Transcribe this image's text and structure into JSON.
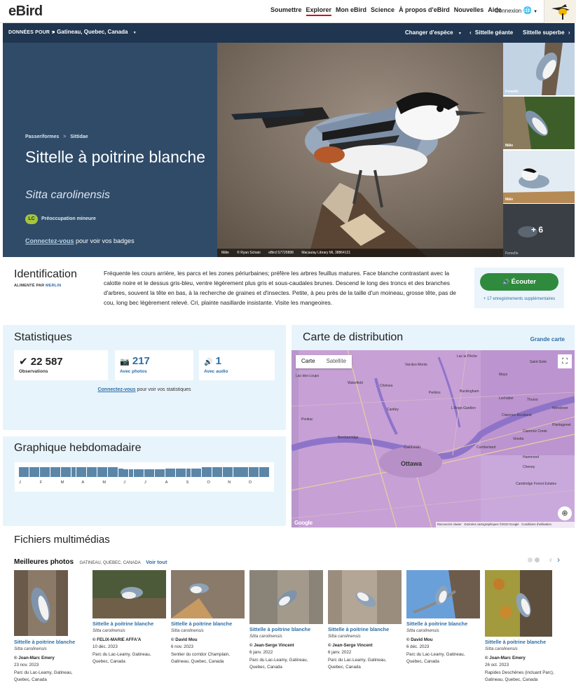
{
  "nav": {
    "logo": "eBird",
    "links": [
      "Soumettre",
      "Explorer",
      "Mon eBird",
      "Science",
      "À propos d'eBird",
      "Nouvelles",
      "Aide"
    ],
    "active": "Explorer",
    "login": "Connexion"
  },
  "subbar": {
    "label": "DONNÉES POUR :",
    "location": "Gatineau, Quebec, Canada",
    "change_species": "Changer d'espèce",
    "prev_species": "Sittelle géante",
    "next_species": "Sittelle superbe"
  },
  "hero": {
    "crumb_order": "Passeriformes",
    "crumb_family": "Sittidae",
    "title": "Sittelle à poitrine blanche",
    "sci_name": "Sitta carolinensis",
    "status_code": "LC",
    "status_label": "Préoccupation mineure",
    "badges_link": "Connectez-vous",
    "badges_text": " pour voir vos badges",
    "caption": {
      "sex": "Mâle",
      "credit": "© Ryan Schain",
      "ebird": "eBird S7720898",
      "library": "Macaulay Library ML 38864121"
    },
    "thumbs": [
      {
        "label": "Femelle"
      },
      {
        "label": "Mâle"
      },
      {
        "label": "Mâle"
      },
      {
        "label": "Femelle"
      }
    ],
    "more_count": "+ 6"
  },
  "identification": {
    "heading": "Identification",
    "powered_by": "ALIMENTÉ PAR",
    "powered_name": "MERLIN",
    "description": "Fréquente les cours arrière, les parcs et les zones périurbaines; préfère les arbres feuillus matures. Face blanche contrastant avec la calotte noire et le dessus gris-bleu, ventre légèrement plus gris et sous-caudales brunes. Descend le long des troncs et des branches d'arbres, souvent la tête en bas, à la recherche de graines et d'insectes. Petite, à peu près de la taille d'un moineau, grosse tête, pas de cou, long bec légèrement relevé. Cri, plainte nasillarde insistante. Visite les mangeoires.",
    "listen": "Écouter",
    "more_recordings": "+ 17 enregistrements supplémentaires"
  },
  "stats": {
    "heading": "Statistiques",
    "observations_value": "22 587",
    "observations_label": "Observations",
    "photos_value": "217",
    "photos_label": "Avec photos",
    "audio_value": "1",
    "audio_label": "Avec audio",
    "login_link": "Connectez-vous",
    "login_text": " pour voir vos statistiques"
  },
  "weekly": {
    "heading": "Graphique hebdomadaire",
    "months": [
      "J",
      "F",
      "M",
      "A",
      "M",
      "J",
      "J",
      "A",
      "S",
      "O",
      "N",
      "D"
    ],
    "bar_levels": [
      1,
      1,
      1,
      1,
      1,
      1,
      1,
      1,
      1,
      1,
      1,
      1,
      1,
      1,
      1,
      1,
      1,
      1,
      1,
      0.85,
      0.8,
      0.8,
      0.8,
      0.8,
      0.8,
      0.8,
      0.8,
      0.8,
      0.85,
      0.85,
      0.85,
      0.85,
      0.85,
      0.85,
      0.85,
      1,
      1,
      1,
      1,
      1,
      1,
      1,
      1,
      1,
      1,
      1,
      1,
      1
    ],
    "bar_color": "#5b86a8"
  },
  "map": {
    "heading": "Carte de distribution",
    "big_map": "Grande carte",
    "btn_map": "Carte",
    "btn_sat": "Satellite",
    "labels": {
      "ottawa": "Ottawa",
      "gatineau": "Gatineau",
      "wakefield": "Wakefield",
      "chelsea": "Chelsea",
      "cantley": "Cantley",
      "val_des_monts": "Val-des-Monts",
      "mayo": "Mayo",
      "thurso": "Thurso",
      "buckingham": "Buckingham",
      "lochaber": "Lochaber",
      "clarence_rockland": "Clarence-Rockland",
      "clarence_creek": "Clarence Creek",
      "vinette": "Vinette",
      "hammond": "Hammond",
      "cheney": "Cheney",
      "plantagenet": "Plantagenet",
      "wendover": "Wendover",
      "lange_gardien": "L'Ange-Gardien",
      "breckenridge": "Breckenridge",
      "pontiac": "Pontiac",
      "lac_des_loups": "Lac-des-Loups",
      "lac_la_peche": "Lac la Pêche",
      "saint_sixte": "Saint-Sixte",
      "perkins": "Perkins",
      "cambridge": "Cambridge Forest Estates",
      "cumberland": "Cumberland"
    },
    "footer_keys": "Raccourcis clavier",
    "footer_data": "Données cartographiques ©2023 Google",
    "footer_terms": "Conditions d'utilisation",
    "google": "Google",
    "fill_color": "#c9a3d8"
  },
  "media": {
    "heading": "Fichiers multimédias",
    "best_photos": "Meilleures photos",
    "location": "GATINEAU, QUEBEC, CANADA",
    "see_all": "Voir tout",
    "cards": [
      {
        "name": "Sittelle à poitrine blanche",
        "sci": "Sitta carolinensis",
        "author": "© Joan-Marc Emery",
        "date": "23 nov. 2023",
        "place": "Parc du Lac-Leamy, Gatineau, Quebec, Canada"
      },
      {
        "name": "Sittelle à poitrine blanche",
        "sci": "Sitta carolinensis",
        "author": "© FELIX-MARIE AFFA'A",
        "date": "10 déc. 2023",
        "place": "Parc du Lac-Leamy, Gatineau, Quebec, Canada"
      },
      {
        "name": "Sittelle à poitrine blanche",
        "sci": "Sitta carolinensis",
        "author": "© David Mou",
        "date": "6 nov. 2023",
        "place": "Sentier du corridor Champlain, Gatineau, Quebec, Canada"
      },
      {
        "name": "Sittelle à poitrine blanche",
        "sci": "Sitta carolinensis",
        "author": "© Jean-Serge Vincent",
        "date": "6 janv. 2022",
        "place": "Parc du Lac-Leamy, Gatineau, Quebec, Canada"
      },
      {
        "name": "Sittelle à poitrine blanche",
        "sci": "Sitta carolinensis",
        "author": "© Jean-Serge Vincent",
        "date": "6 janv. 2022",
        "place": "Parc du Lac-Leamy, Gatineau, Quebec, Canada"
      },
      {
        "name": "Sittelle à poitrine blanche",
        "sci": "Sitta carolinensis",
        "author": "© David Mou",
        "date": "6 déc. 2023",
        "place": "Parc du Lac-Leamy, Gatineau, Quebec, Canada"
      },
      {
        "name": "Sittelle à poitrine blanche",
        "sci": "Sitta carolinensis",
        "author": "© Joan-Marc Emery",
        "date": "26 oct. 2023",
        "place": "Rapides Deschênes (incluant Parc), Gatineau, Quebec, Canada"
      }
    ]
  },
  "colors": {
    "brand_green": "#36824b",
    "navy": "#1f3550",
    "hero_blue": "#2f4b68",
    "link_blue": "#2e6ea6",
    "listen_green": "#2f8a3e",
    "panel_bg": "#e8f4fb"
  }
}
